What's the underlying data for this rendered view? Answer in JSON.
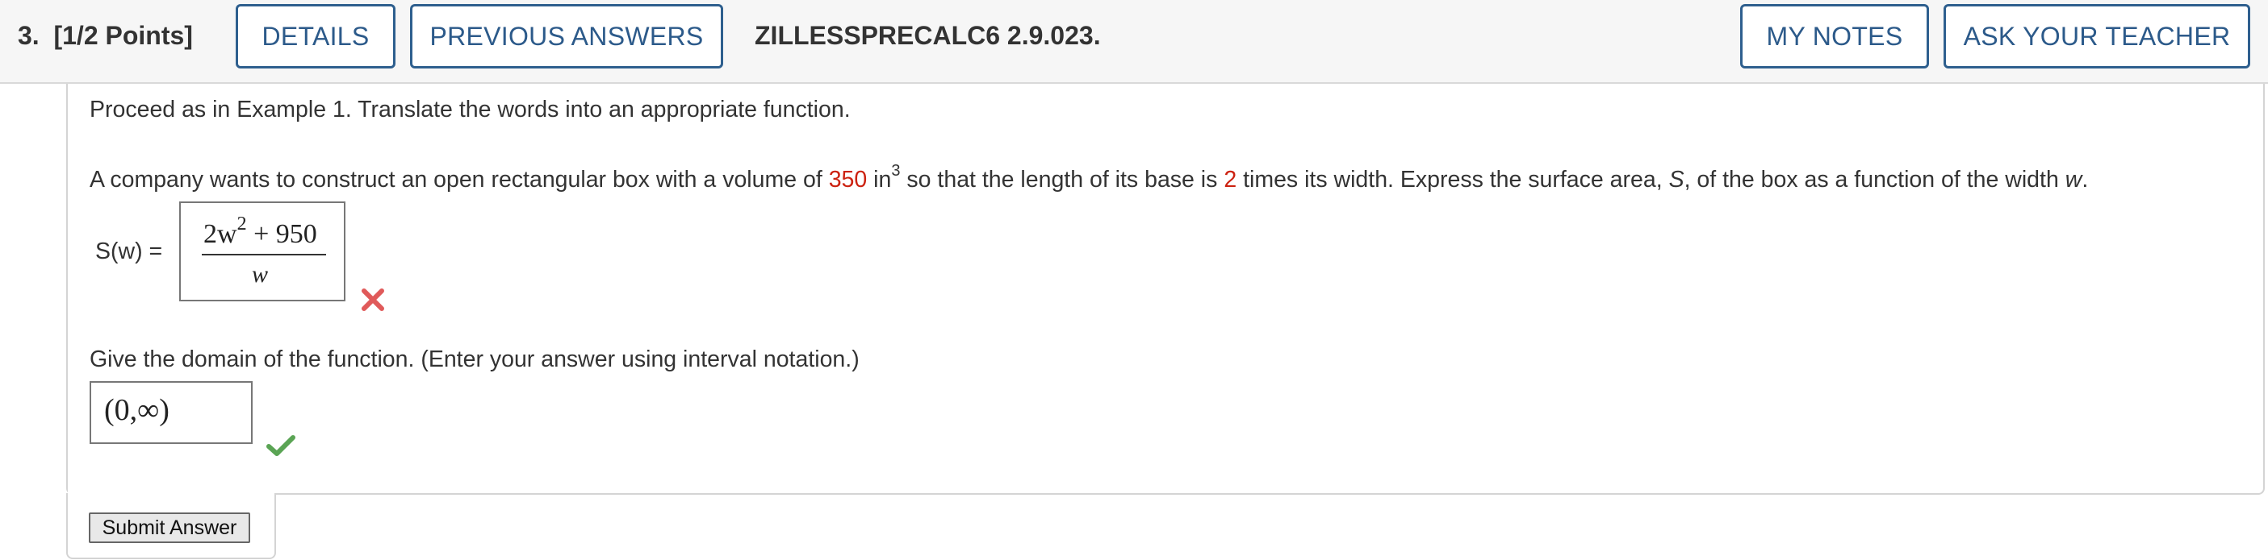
{
  "header": {
    "question_number": "3.",
    "points": "[1/2 Points]",
    "details_label": "DETAILS",
    "previous_answers_label": "PREVIOUS ANSWERS",
    "question_id": "ZILLESSPRECALC6 2.9.023.",
    "my_notes_label": "MY NOTES",
    "ask_teacher_label": "ASK YOUR TEACHER",
    "button_color": "#2c5a8a"
  },
  "question": {
    "instruction": "Proceed as in Example 1. Translate the words into an appropriate function.",
    "problem_part1": "A company wants to construct an open rectangular box with a volume of ",
    "volume_value": "350",
    "volume_unit": " in",
    "volume_exponent": "3",
    "problem_part2": " so that the length of its base is ",
    "ratio_value": "2",
    "problem_part3": " times its width. Express the surface area, ",
    "area_var": "S",
    "problem_part4": ", of the box as a function of the width ",
    "width_var": "w",
    "problem_part5": ".",
    "highlight_color": "#cc2211"
  },
  "part1": {
    "label": "S(w) =",
    "numerator_coeff": "2w",
    "numerator_exp": "2",
    "numerator_rest": " + 950",
    "denominator": "w",
    "status": "incorrect",
    "status_icon": "x-mark-icon",
    "status_color": "#e05a5a"
  },
  "part2": {
    "prompt": "Give the domain of the function. (Enter your answer using interval notation.)",
    "answer": "(0,∞)",
    "status": "correct",
    "status_icon": "check-mark-icon",
    "status_color": "#5aa454"
  },
  "submit": {
    "label": "Submit Answer"
  }
}
